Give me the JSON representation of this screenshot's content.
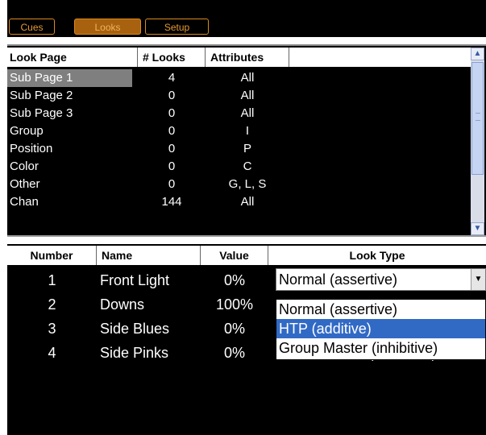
{
  "tabs": [
    {
      "label": "Cues",
      "active": false
    },
    {
      "label": "Looks",
      "active": true
    },
    {
      "label": "Setup",
      "active": false
    }
  ],
  "look_pages": {
    "headers": [
      "Look Page",
      "# Looks",
      "Attributes",
      ""
    ],
    "rows": [
      {
        "page": "Sub Page 1",
        "looks": "4",
        "attributes": "All",
        "selected": true
      },
      {
        "page": "Sub Page 2",
        "looks": "0",
        "attributes": "All"
      },
      {
        "page": "Sub Page 3",
        "looks": "0",
        "attributes": "All"
      },
      {
        "page": "Group",
        "looks": "0",
        "attributes": "I"
      },
      {
        "page": "Position",
        "looks": "0",
        "attributes": "P"
      },
      {
        "page": "Color",
        "looks": "0",
        "attributes": "C"
      },
      {
        "page": "Other",
        "looks": "0",
        "attributes": "G, L, S"
      },
      {
        "page": "Chan",
        "looks": "144",
        "attributes": "All"
      }
    ],
    "scrollbar": {
      "up_icon": "chevron-up-icon",
      "down_icon": "chevron-down-icon",
      "up_glyph": "▲",
      "down_glyph": "▼"
    }
  },
  "looks": {
    "headers": [
      "Number",
      "Name",
      "Value",
      "Look Type"
    ],
    "rows": [
      {
        "number": "1",
        "name": "Front Light",
        "value": "0%",
        "look_type": ""
      },
      {
        "number": "2",
        "name": "Downs",
        "value": "100%",
        "look_type": ""
      },
      {
        "number": "3",
        "name": "Side Blues",
        "value": "0%",
        "look_type": ""
      },
      {
        "number": "4",
        "name": "Side Pinks",
        "value": "0%",
        "look_type": "Normal (assertive)"
      }
    ],
    "look_type_combo": {
      "value": "Normal (assertive)",
      "arrow_glyph": "▼",
      "options": [
        {
          "label": "Normal (assertive)",
          "selected": false
        },
        {
          "label": "HTP (additive)",
          "selected": true
        },
        {
          "label": "Group Master (inhibitive)",
          "selected": false
        }
      ]
    }
  },
  "colors": {
    "accent": "#d98a1c",
    "selection": "#316ac5",
    "row_selected": "#7f7f7f"
  }
}
